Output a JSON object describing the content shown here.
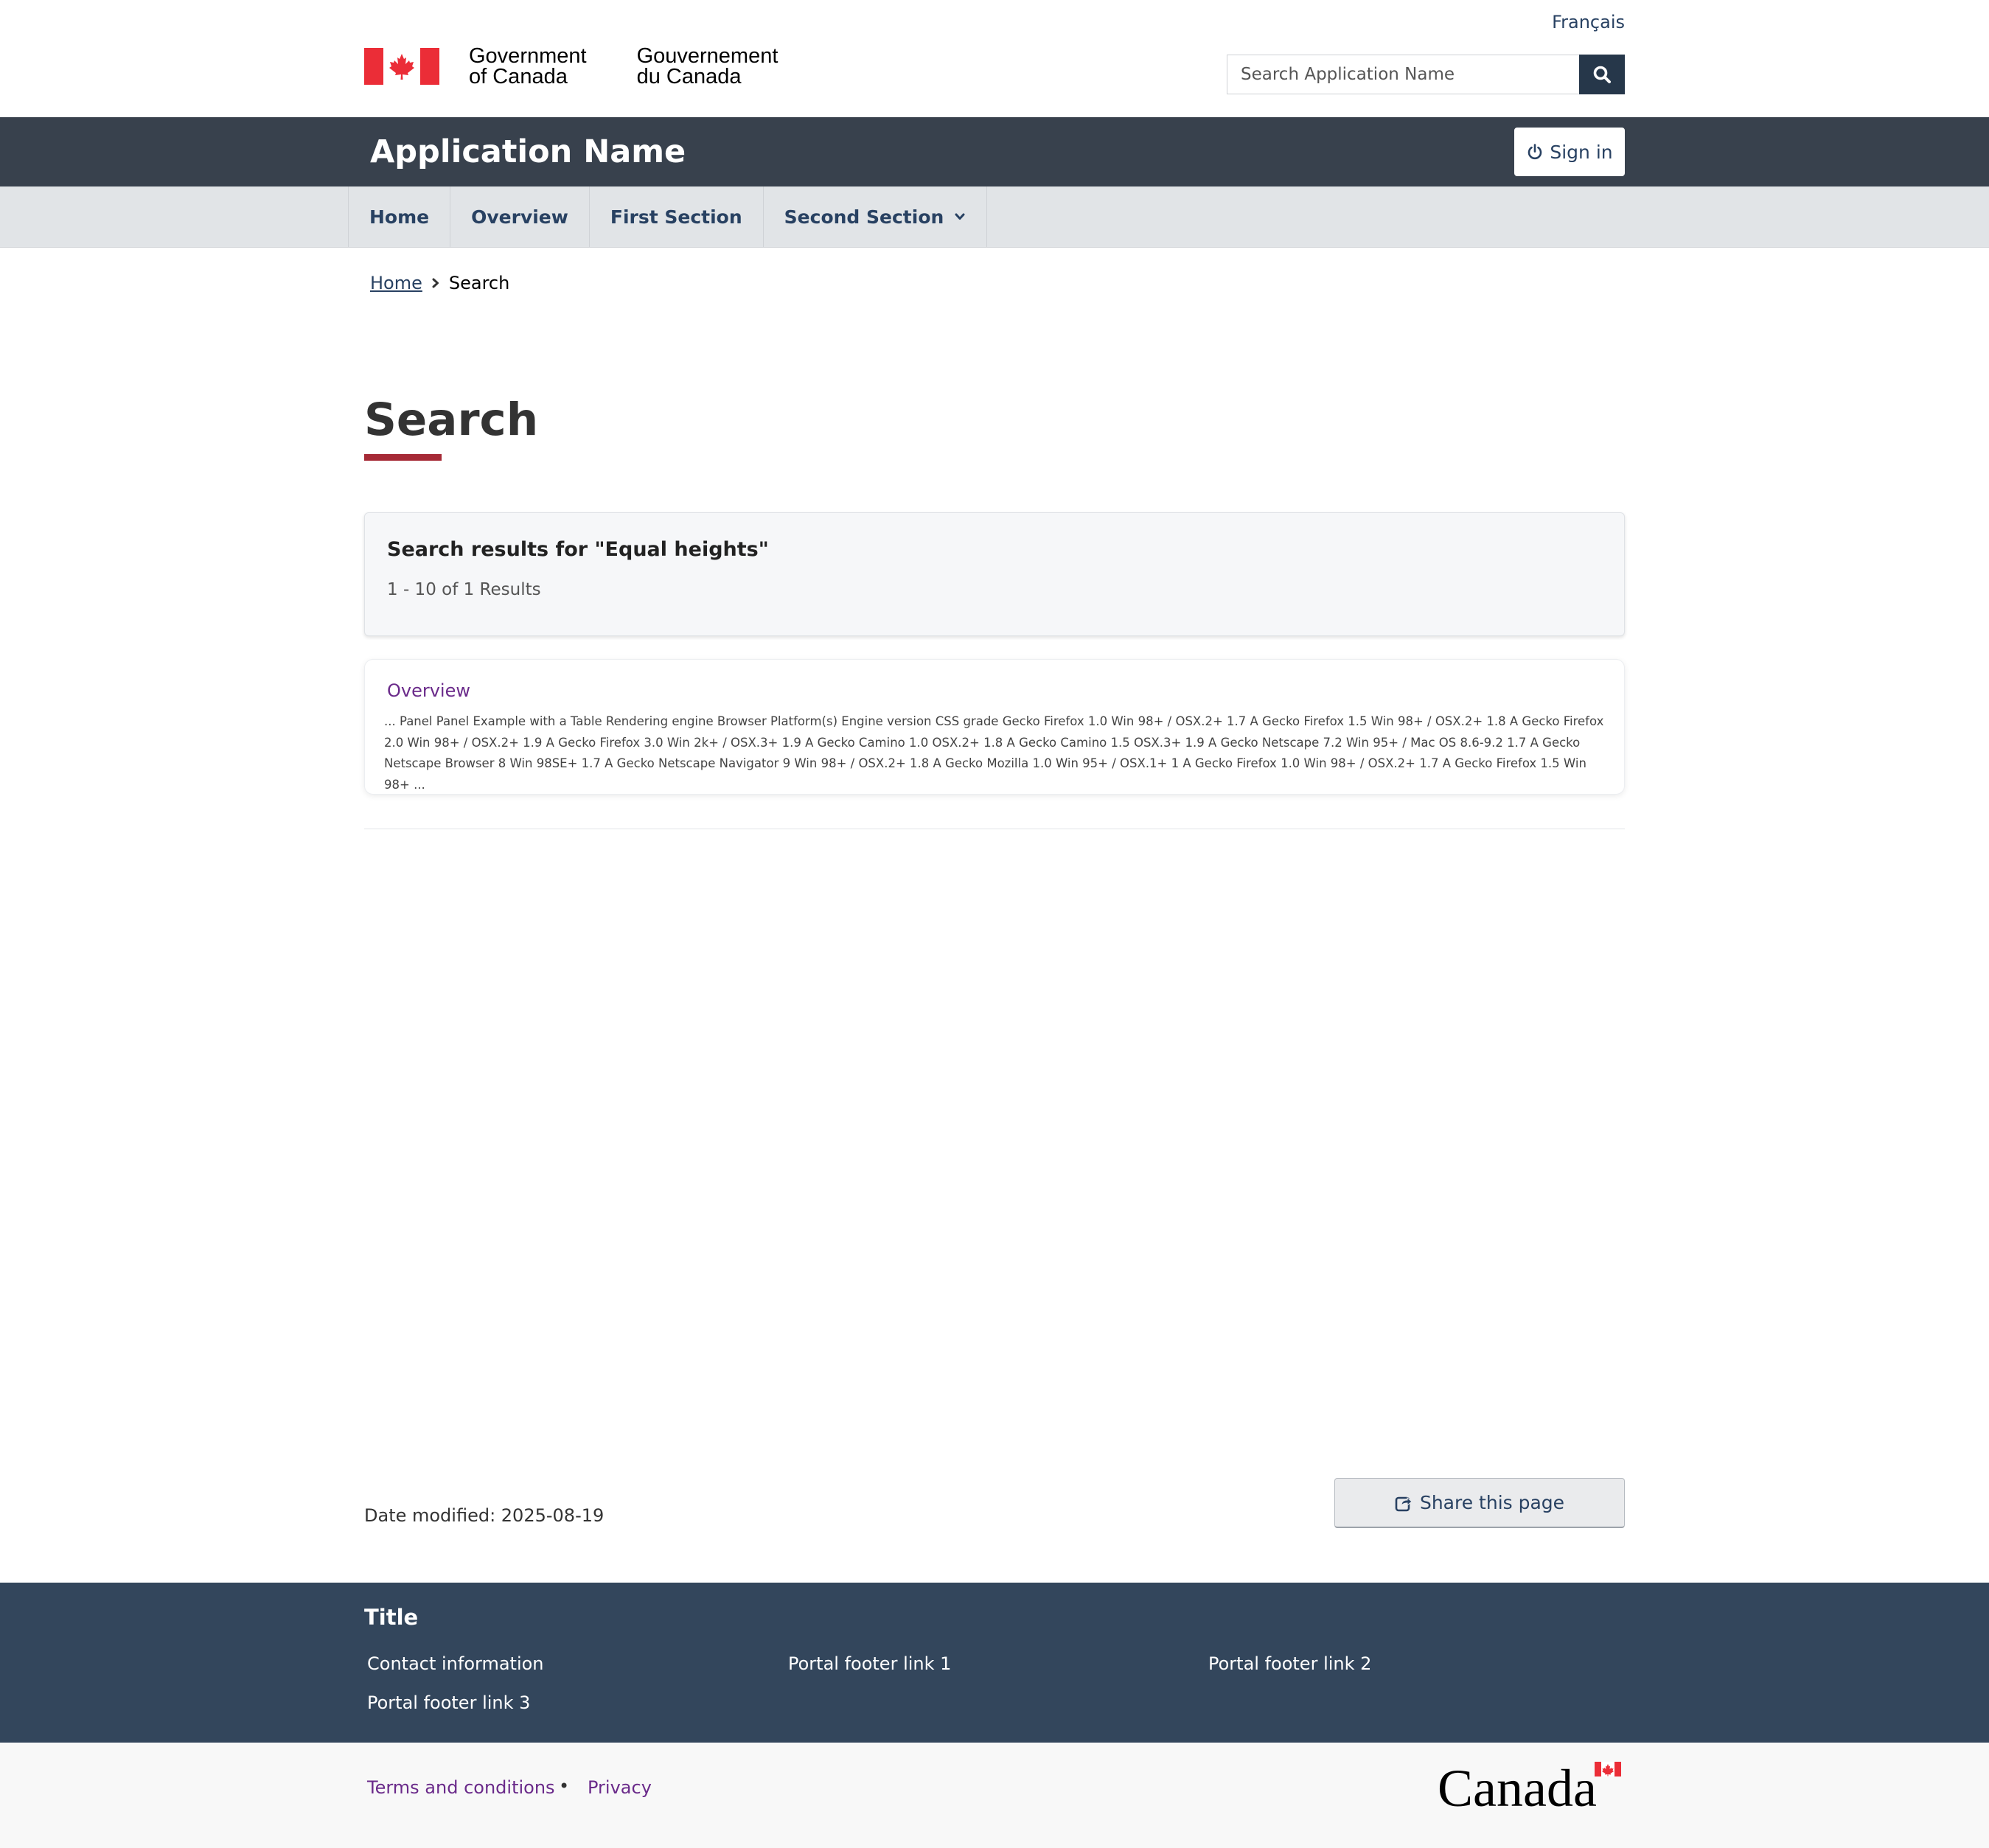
{
  "header": {
    "language_toggle": "Français",
    "signature": {
      "en_line1": "Government",
      "en_line2": "of Canada",
      "fr_line1": "Gouvernement",
      "fr_line2": "du Canada"
    },
    "search": {
      "placeholder": "Search Application Name"
    }
  },
  "app_bar": {
    "app_name": "Application Name",
    "sign_in_label": "Sign in"
  },
  "menu": {
    "items": [
      {
        "label": "Home"
      },
      {
        "label": "Overview"
      },
      {
        "label": "First Section"
      },
      {
        "label": "Second Section",
        "has_dropdown": true
      }
    ]
  },
  "breadcrumb": {
    "home": "Home",
    "current": "Search"
  },
  "main": {
    "title": "Search",
    "summary_heading": "Search results for \"Equal heights\"",
    "summary_count": "1 - 10 of 1 Results",
    "results": [
      {
        "title": "Overview",
        "snippet": "... Panel Panel Example with a Table Rendering engine Browser Platform(s) Engine version CSS grade Gecko Firefox 1.0 Win 98+ / OSX.2+ 1.7 A Gecko Firefox 1.5 Win 98+ / OSX.2+ 1.8 A Gecko Firefox 2.0 Win 98+ / OSX.2+ 1.9 A Gecko Firefox 3.0 Win 2k+ / OSX.3+ 1.9 A Gecko Camino 1.0 OSX.2+ 1.8 A Gecko Camino 1.5 OSX.3+ 1.9 A Gecko Netscape 7.2 Win 95+ / Mac OS 8.6-9.2 1.7 A Gecko Netscape Browser 8 Win 98SE+ 1.7 A Gecko Netscape Navigator 9 Win 98+ / OSX.2+ 1.8 A Gecko Mozilla 1.0 Win 95+ / OSX.1+ 1 A Gecko Firefox 1.0 Win 98+ / OSX.2+ 1.7 A Gecko Firefox 1.5 Win 98+ ..."
      }
    ]
  },
  "page_details": {
    "date_modified": "Date modified: 2025-08-19",
    "share_label": "Share this page"
  },
  "footer": {
    "title": "Title",
    "links": [
      "Contact information",
      "Portal footer link 1",
      "Portal footer link 2",
      "Portal footer link 3"
    ],
    "sub_links": [
      "Terms and conditions",
      "Privacy"
    ],
    "wordmark": "Canada"
  },
  "colors": {
    "app_bar_bg": "#38414d",
    "menu_bg": "#e1e4e7",
    "footer_bg": "#33465c",
    "link_blue": "#284162",
    "visited_purple": "#6a2a8a",
    "title_underline": "#a62a36",
    "flag_red": "#eb2d37"
  },
  "icons": {
    "search_button": "search-icon",
    "sign_in": "power-icon",
    "breadcrumb_separator": "chevron-right-icon",
    "menu_dropdown": "chevron-down-icon",
    "share": "share-icon"
  }
}
